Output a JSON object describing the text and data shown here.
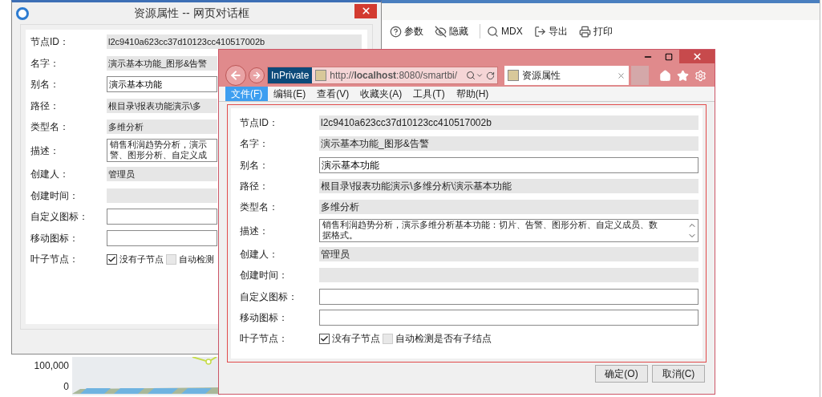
{
  "background_page": {
    "toolbar": [
      {
        "label": "参数"
      },
      {
        "label": "隐藏"
      },
      {
        "label": "MDX"
      },
      {
        "label": "导出"
      },
      {
        "label": "打印"
      }
    ],
    "chart": {
      "y_labels": [
        "100,000",
        "0"
      ]
    }
  },
  "background_dialog": {
    "title": "资源属性 -- 网页对话框",
    "fields": [
      {
        "label": "节点ID：",
        "kind": "readonly",
        "value": "l2c9410a623cc37d10123cc410517002b"
      },
      {
        "label": "名字：",
        "kind": "readonly",
        "value": "演示基本功能_图形&告警"
      },
      {
        "label": "别名：",
        "kind": "input",
        "value": "演示基本功能"
      },
      {
        "label": "路径：",
        "kind": "readonly",
        "value": "根目录\\报表功能演示\\多"
      },
      {
        "label": "类型名：",
        "kind": "readonly",
        "value": "多维分析"
      },
      {
        "label": "描述：",
        "kind": "textarea",
        "lines": [
          "销售利润趋势分析，演示",
          "警、图形分析、自定义成"
        ]
      },
      {
        "label": "创建人：",
        "kind": "readonly",
        "value": "管理员"
      },
      {
        "label": "创建时间：",
        "kind": "readonly"
      },
      {
        "label": "自定义图标：",
        "kind": "input"
      },
      {
        "label": "移动图标：",
        "kind": "input"
      },
      {
        "label": "叶子节点：",
        "kind": "checks",
        "options": [
          {
            "label": "没有子节点",
            "checked": true
          },
          {
            "label": "自动检测",
            "checked": false
          }
        ]
      }
    ]
  },
  "browser_window": {
    "inprivate": "InPrivate",
    "address": "http://**localhost**:8080/smartbi/",
    "tab": {
      "title": "资源属性"
    },
    "menu": [
      {
        "label": "文件(F)",
        "selected": true
      },
      {
        "label": "编辑(E)",
        "selected": false
      },
      {
        "label": "查看(V)",
        "selected": false
      },
      {
        "label": "收藏夹(A)",
        "selected": false
      },
      {
        "label": "工具(T)",
        "selected": false
      },
      {
        "label": "帮助(H)",
        "selected": false
      }
    ],
    "fields": [
      {
        "label": "节点ID：",
        "kind": "readonly",
        "value": "l2c9410a623cc37d10123cc410517002b"
      },
      {
        "label": "名字：",
        "kind": "readonly",
        "value": "演示基本功能_图形&告警"
      },
      {
        "label": "别名：",
        "kind": "input",
        "value": "演示基本功能"
      },
      {
        "label": "路径：",
        "kind": "readonly",
        "value": "根目录\\报表功能演示\\多维分析\\演示基本功能"
      },
      {
        "label": "类型名：",
        "kind": "readonly",
        "value": "多维分析"
      },
      {
        "label": "描述：",
        "kind": "textarea",
        "lines": [
          "销售利润趋势分析，演示多维分析基本功能：切片、告警、图形分析、自定义成员、数",
          "据格式。"
        ]
      },
      {
        "label": "创建人：",
        "kind": "readonly",
        "value": "管理员"
      },
      {
        "label": "创建时间：",
        "kind": "readonly"
      },
      {
        "label": "自定义图标：",
        "kind": "input"
      },
      {
        "label": "移动图标：",
        "kind": "input"
      },
      {
        "label": "叶子节点：",
        "kind": "checks",
        "options": [
          {
            "label": "没有子节点",
            "checked": true
          },
          {
            "label": "自动检测是否有子结点",
            "checked": false
          }
        ]
      }
    ],
    "buttons": [
      "确定(O)",
      "取消(C)"
    ]
  }
}
